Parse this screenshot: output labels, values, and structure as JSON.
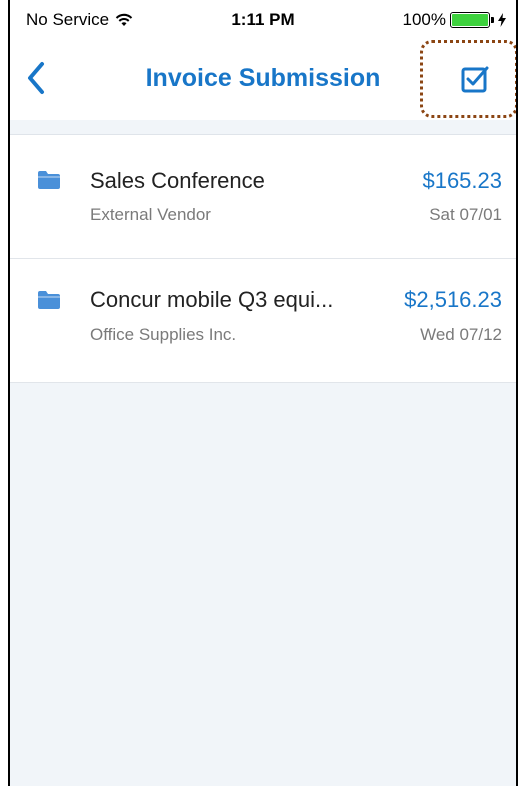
{
  "status_bar": {
    "carrier": "No Service",
    "time": "1:11 PM",
    "battery_percent": "100%",
    "battery_level": 1.0
  },
  "nav": {
    "title": "Invoice Submission",
    "back_icon": "chevron-left-icon",
    "action_icon": "checkbox-icon"
  },
  "invoices": [
    {
      "name": "Sales Conference",
      "vendor": "External Vendor",
      "amount": "$165.23",
      "date": "Sat 07/01"
    },
    {
      "name": "Concur mobile Q3 equi...",
      "vendor": "Office Supplies Inc.",
      "amount": "$2,516.23",
      "date": "Wed 07/12"
    }
  ],
  "colors": {
    "accent": "#1876c8",
    "folder": "#4a90d9",
    "battery": "#3ed23e",
    "highlight_border": "#8b4513",
    "background": "#f1f5f9"
  }
}
